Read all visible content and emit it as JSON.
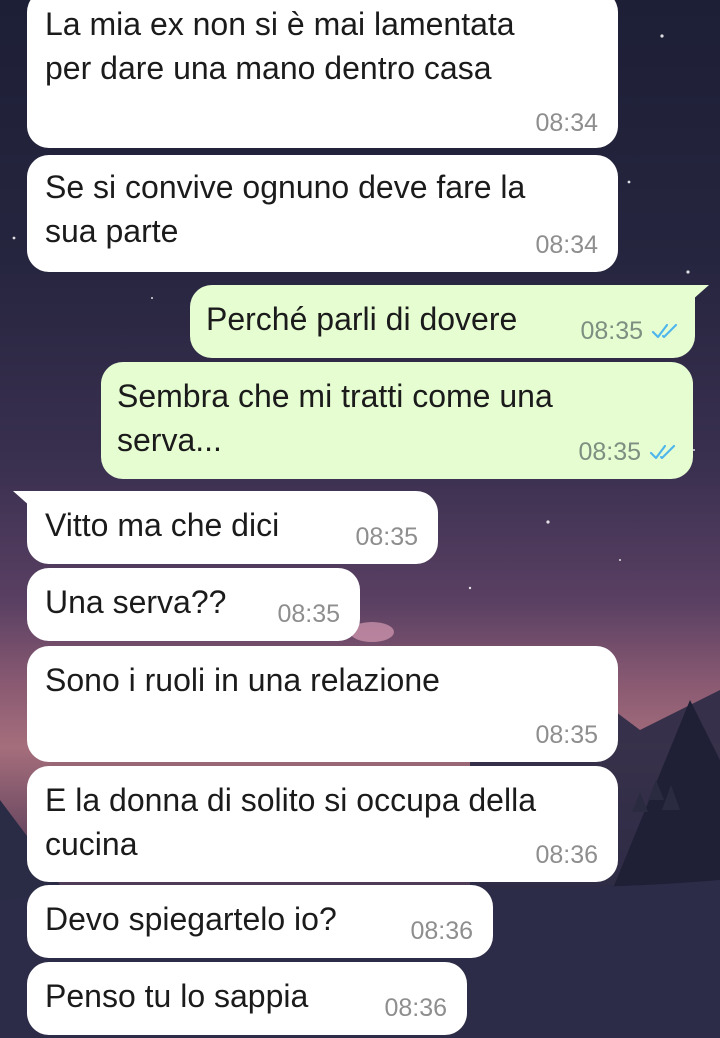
{
  "chat": {
    "messages": [
      {
        "id": "m1",
        "direction": "incoming",
        "text": "La mia ex non si è mai lamentata\nper dare una mano dentro casa",
        "time": "08:34"
      },
      {
        "id": "m2",
        "direction": "incoming",
        "text": "Se si convive ognuno deve fare la\nsua parte",
        "time": "08:34"
      },
      {
        "id": "m3",
        "direction": "outgoing",
        "text": "Perché parli di dovere",
        "time": "08:35",
        "status": "read-double-check-icon"
      },
      {
        "id": "m4",
        "direction": "outgoing",
        "text": "Sembra che mi tratti come una\nserva...",
        "time": "08:35",
        "status": "read-double-check-icon"
      },
      {
        "id": "m5",
        "direction": "incoming",
        "text": "Vitto ma che dici",
        "time": "08:35"
      },
      {
        "id": "m6",
        "direction": "incoming",
        "text": "Una serva??",
        "time": "08:35"
      },
      {
        "id": "m7",
        "direction": "incoming",
        "text": "Sono i ruoli in una relazione",
        "time": "08:35"
      },
      {
        "id": "m8",
        "direction": "incoming",
        "text": "E la donna di solito si occupa della\ncucina",
        "time": "08:36"
      },
      {
        "id": "m9",
        "direction": "incoming",
        "text": "Devo spiegartelo io?",
        "time": "08:36"
      },
      {
        "id": "m10",
        "direction": "incoming",
        "text": "Penso tu lo sappia",
        "time": "08:36"
      }
    ]
  },
  "colors": {
    "incoming_bubble": "#ffffff",
    "outgoing_bubble": "#e6fdd2",
    "read_tick": "#4fb6ec",
    "timestamp": "#8e8e8e"
  }
}
